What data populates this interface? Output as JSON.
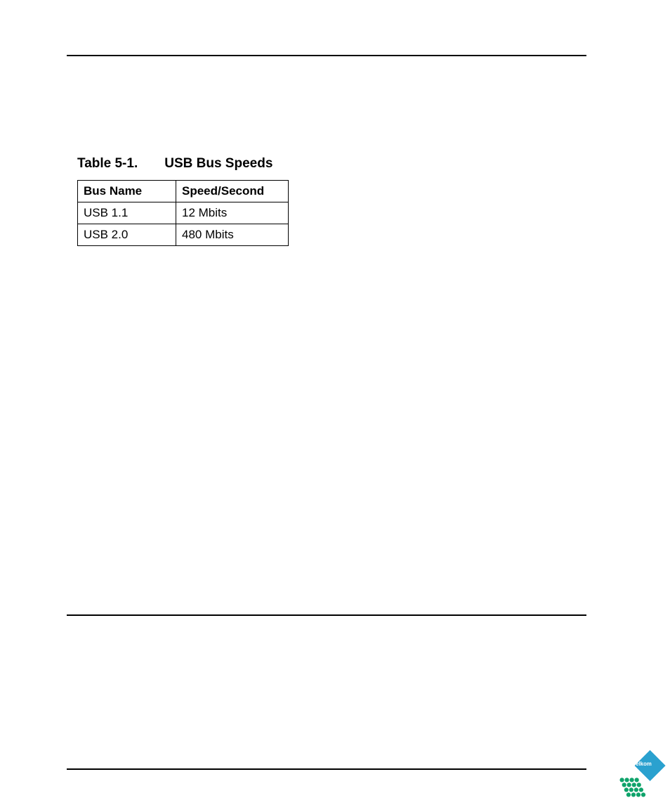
{
  "table": {
    "number": "Table 5-1.",
    "title": "USB Bus Speeds",
    "columns": [
      "Bus Name",
      "Speed/Second"
    ],
    "rows": [
      {
        "bus": "USB 1.1",
        "speed": "12 Mbits"
      },
      {
        "bus": "USB 2.0",
        "speed": "480 Mbits"
      }
    ]
  },
  "logo": {
    "name": "Telkom",
    "colors": {
      "diamond": "#2aa1cf",
      "dots": "#0fa36b",
      "text": "#ffffff"
    }
  },
  "chart_data": {
    "type": "table",
    "title": "USB Bus Speeds",
    "columns": [
      "Bus Name",
      "Speed/Second"
    ],
    "rows": [
      [
        "USB 1.1",
        "12 Mbits"
      ],
      [
        "USB 2.0",
        "480 Mbits"
      ]
    ]
  }
}
